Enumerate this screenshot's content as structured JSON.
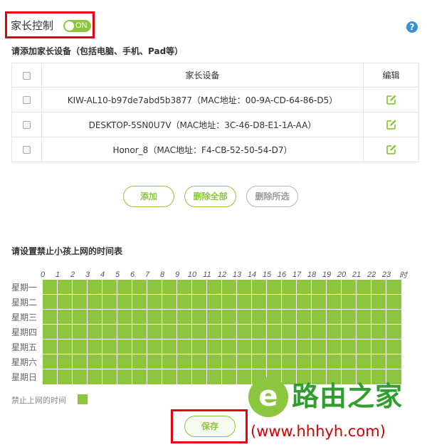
{
  "header": {
    "title": "家长控制",
    "toggle_label": "ON",
    "help_symbol": "?"
  },
  "devices_section": {
    "title": "请添加家长设备（包括电脑、手机、Pad等）",
    "columns": [
      "家长设备",
      "编辑"
    ],
    "rows": [
      {
        "device": "KIW-AL10-b97de7abd5b3877（MAC地址：00-9A-CD-64-86-D5）"
      },
      {
        "device": "DESKTOP-5SN0U7V（MAC地址：3C-46-D8-E1-1A-AA）"
      },
      {
        "device": "Honor_8（MAC地址：F4-CB-52-50-54-D7）"
      }
    ]
  },
  "buttons": {
    "add": "添加",
    "delete_all": "删除全部",
    "delete_selected": "删除所选"
  },
  "schedule": {
    "title": "请设置禁止小孩上网的时间表",
    "hours": [
      "0",
      "1",
      "2",
      "3",
      "4",
      "5",
      "6",
      "7",
      "8",
      "9",
      "10",
      "11",
      "12",
      "13",
      "14",
      "15",
      "16",
      "17",
      "18",
      "19",
      "20",
      "21",
      "22",
      "23"
    ],
    "hour_unit": "时",
    "days": [
      "星期一",
      "星期二",
      "星期三",
      "星期四",
      "星期五",
      "星期六",
      "星期日"
    ],
    "blocked_all": true,
    "legend": "禁止上网的时间"
  },
  "save_label": "保存",
  "watermark": {
    "logo_glyph": "e",
    "name": "路由之家",
    "url": "(www.hhhyh.com)"
  },
  "colors": {
    "accent": "#8cc63f",
    "highlight_box": "#e60012",
    "help": "#3b8ed8",
    "watermark_name": "#2f9e2f",
    "watermark_url": "#d40000"
  }
}
